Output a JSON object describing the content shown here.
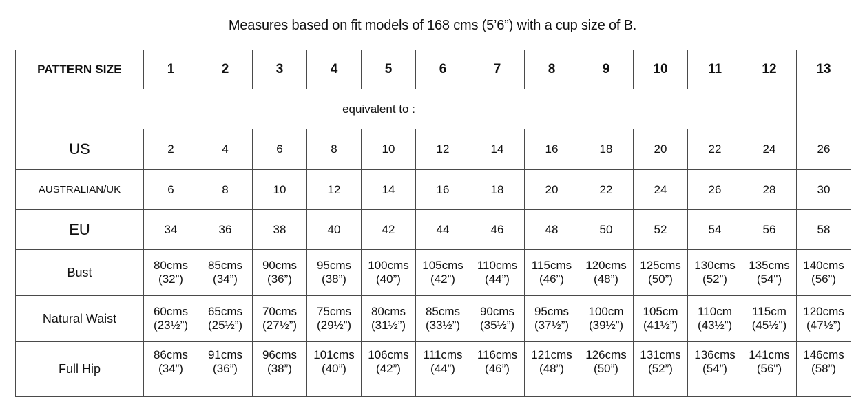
{
  "caption": "Measures based on fit models of 168 cms (5’6”) with a cup size of B.",
  "table": {
    "header": {
      "label": "PATTERN SIZE",
      "sizes": [
        "1",
        "2",
        "3",
        "4",
        "5",
        "6",
        "7",
        "8",
        "9",
        "10",
        "11",
        "12",
        "13"
      ]
    },
    "equivalent_row": {
      "label": "equivalent to :",
      "empty_cells": [
        "",
        ""
      ]
    },
    "rows": [
      {
        "label": "US",
        "label_style": "big",
        "values": [
          "2",
          "4",
          "6",
          "8",
          "10",
          "12",
          "14",
          "16",
          "18",
          "20",
          "22",
          "24",
          "26"
        ]
      },
      {
        "label": "AUSTRALIAN/UK",
        "label_style": "small",
        "values": [
          "6",
          "8",
          "10",
          "12",
          "14",
          "16",
          "18",
          "20",
          "22",
          "24",
          "26",
          "28",
          "30"
        ]
      },
      {
        "label": "EU",
        "label_style": "big",
        "values": [
          "34",
          "36",
          "38",
          "40",
          "42",
          "44",
          "46",
          "48",
          "50",
          "52",
          "54",
          "56",
          "58"
        ]
      }
    ],
    "measurement_rows": [
      {
        "label": "Bust",
        "cells": [
          {
            "cm": "80cms",
            "inch": "(32”)"
          },
          {
            "cm": "85cms",
            "inch": "(34”)"
          },
          {
            "cm": "90cms",
            "inch": "(36”)"
          },
          {
            "cm": "95cms",
            "inch": "(38”)"
          },
          {
            "cm": "100cms",
            "inch": "(40”)"
          },
          {
            "cm": "105cms",
            "inch": "(42”)"
          },
          {
            "cm": "110cms",
            "inch": "(44”)"
          },
          {
            "cm": "115cms",
            "inch": "(46”)"
          },
          {
            "cm": "120cms",
            "inch": "(48”)"
          },
          {
            "cm": "125cms",
            "inch": "(50”)"
          },
          {
            "cm": "130cms",
            "inch": "(52”)"
          },
          {
            "cm": "135cms",
            "inch": "(54\")"
          },
          {
            "cm": "140cms",
            "inch": "(56”)"
          }
        ]
      },
      {
        "label": "Natural Waist",
        "cells": [
          {
            "cm": "60cms",
            "inch": "(23½”)"
          },
          {
            "cm": "65cms",
            "inch": "(25½”)"
          },
          {
            "cm": "70cms",
            "inch": "(27½”)"
          },
          {
            "cm": "75cms",
            "inch": "(29½”)"
          },
          {
            "cm": "80cms",
            "inch": "(31½”)"
          },
          {
            "cm": "85cms",
            "inch": "(33½”)"
          },
          {
            "cm": "90cms",
            "inch": "(35½”)"
          },
          {
            "cm": "95cms",
            "inch": "(37½”)"
          },
          {
            "cm": "100cm",
            "inch": "(39½”)"
          },
          {
            "cm": "105cm",
            "inch": "(41½”)"
          },
          {
            "cm": "110cm",
            "inch": "(43½”)"
          },
          {
            "cm": "115cm",
            "inch": "(45½\")"
          },
          {
            "cm": "120cms",
            "inch": "(47½”)"
          }
        ]
      },
      {
        "label": "Full Hip",
        "cells": [
          {
            "cm": "86cms",
            "inch": "(34”)"
          },
          {
            "cm": "91cms",
            "inch": "(36”)"
          },
          {
            "cm": "96cms",
            "inch": "(38”)"
          },
          {
            "cm": "101cms",
            "inch": "(40”)"
          },
          {
            "cm": "106cms",
            "inch": "(42”)"
          },
          {
            "cm": "111cms",
            "inch": "(44”)"
          },
          {
            "cm": "116cms",
            "inch": "(46”)"
          },
          {
            "cm": "121cms",
            "inch": "(48”)"
          },
          {
            "cm": "126cms",
            "inch": "(50”)"
          },
          {
            "cm": "131cms",
            "inch": "(52”)"
          },
          {
            "cm": "136cms",
            "inch": "(54”)"
          },
          {
            "cm": "141cms",
            "inch": "(56\")"
          },
          {
            "cm": "146cms",
            "inch": "(58”)"
          }
        ]
      }
    ]
  },
  "colors": {
    "border": "#4a4a4a",
    "text": "#111111",
    "background": "#ffffff"
  }
}
